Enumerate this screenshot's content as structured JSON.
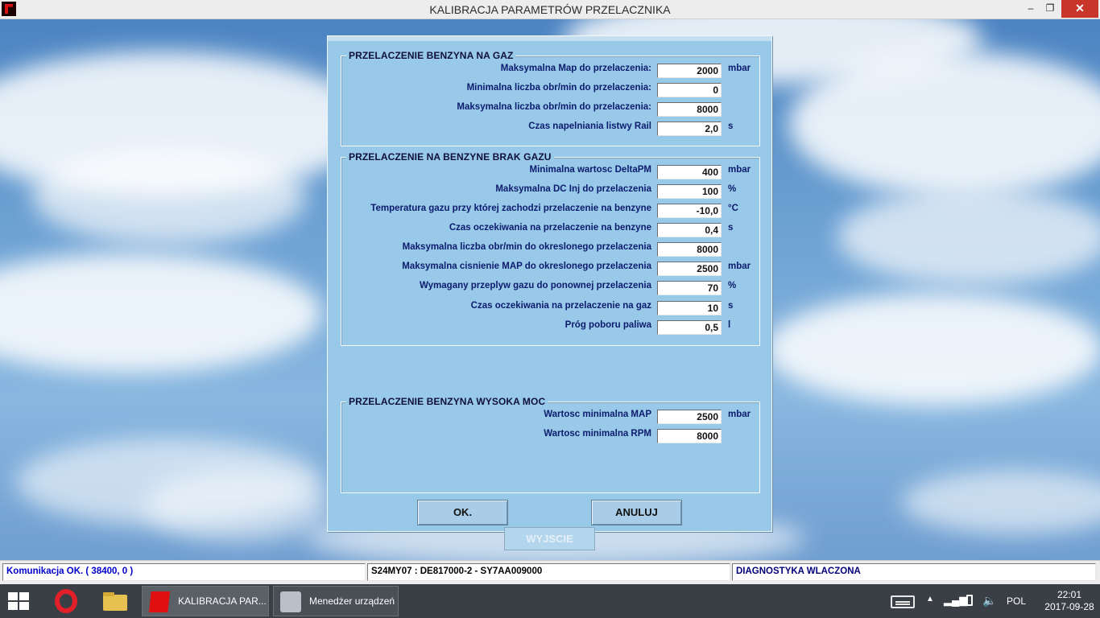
{
  "window": {
    "title": "KALIBRACJA PARAMETRÓW PRZELACZNIKA",
    "min_glyph": "–",
    "max_glyph": "❐",
    "close_glyph": "✕"
  },
  "groups": [
    {
      "legend": "PRZELACZENIE BENZYNA NA GAZ",
      "rows": [
        {
          "label": "Maksymalna Map do przelaczenia:",
          "value": "2000",
          "unit": "mbar"
        },
        {
          "label": "Minimalna liczba obr/min do przelaczenia:",
          "value": "0",
          "unit": ""
        },
        {
          "label": "Maksymalna liczba obr/min do przelaczenia:",
          "value": "8000",
          "unit": ""
        },
        {
          "label": "Czas napelniania listwy Rail",
          "value": "2,0",
          "unit": "s"
        }
      ]
    },
    {
      "legend": "PRZELACZENIE NA BENZYNE BRAK GAZU",
      "rows": [
        {
          "label": "Minimalna wartosc DeltaPM",
          "value": "400",
          "unit": "mbar"
        },
        {
          "label": "Maksymalna DC Inj do przelaczenia",
          "value": "100",
          "unit": "%"
        },
        {
          "label": "Temperatura gazu przy której zachodzi przelaczenie na benzyne",
          "value": "-10,0",
          "unit": "°C"
        },
        {
          "label": "Czas oczekiwania na przelaczenie na benzyne",
          "value": "0,4",
          "unit": "s"
        },
        {
          "label": "Maksymalna liczba obr/min do okreslonego przelaczenia",
          "value": "8000",
          "unit": ""
        },
        {
          "label": "Maksymalna cisnienie MAP do okreslonego przelaczenia",
          "value": "2500",
          "unit": "mbar"
        },
        {
          "label": "Wymagany przeplyw gazu do ponownej przelaczenia",
          "value": "70",
          "unit": "%"
        },
        {
          "label": "Czas oczekiwania na przelaczenie na gaz",
          "value": "10",
          "unit": "s"
        },
        {
          "label": "Próg poboru paliwa",
          "value": "0,5",
          "unit": "l"
        }
      ]
    },
    {
      "legend": "PRZELACZENIE BENZYNA WYSOKA MOC",
      "rows": [
        {
          "label": "Wartosc minimalna MAP",
          "value": "2500",
          "unit": "mbar"
        },
        {
          "label": "Wartosc minimalna RPM",
          "value": "8000",
          "unit": ""
        }
      ]
    }
  ],
  "buttons": {
    "ok": "OK.",
    "cancel": "ANULUJ",
    "exit": "WYJSCIE"
  },
  "status": {
    "comm": "Komunikacja OK. ( 38400,  0 )",
    "device": "S24MY07 : DE817000-2 - SY7AA009000",
    "diag": "DIAGNOSTYKA WLACZONA",
    "comm_color": "#0000cc",
    "device_color": "#000000",
    "diag_color": "#00007a"
  },
  "taskbar": {
    "task_active": "KALIBRACJA PAR...",
    "task_other": "Menedżer urządzeń",
    "language": "POL",
    "time": "22:01",
    "date": "2017-09-28"
  }
}
